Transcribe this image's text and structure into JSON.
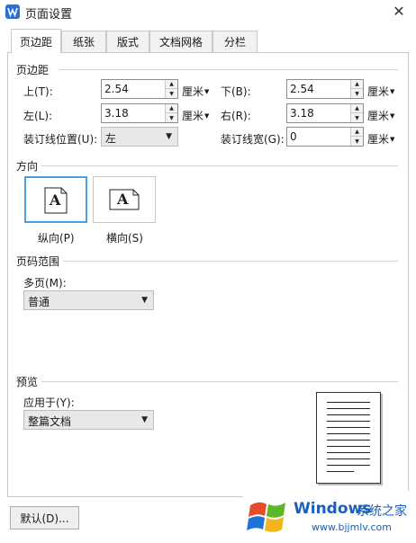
{
  "window": {
    "title": "页面设置",
    "close_glyph": "✕"
  },
  "tabs": [
    {
      "label": "页边距",
      "active": true
    },
    {
      "label": "纸张"
    },
    {
      "label": "版式"
    },
    {
      "label": "文档网格"
    },
    {
      "label": "分栏"
    }
  ],
  "margins": {
    "section_title": "页边距",
    "top": {
      "label": "上(T):",
      "value": "2.54",
      "unit": "厘米"
    },
    "bottom": {
      "label": "下(B):",
      "value": "2.54",
      "unit": "厘米"
    },
    "left": {
      "label": "左(L):",
      "value": "3.18",
      "unit": "厘米"
    },
    "right": {
      "label": "右(R):",
      "value": "3.18",
      "unit": "厘米"
    },
    "gutter_position": {
      "label": "装订线位置(U):",
      "value": "左"
    },
    "gutter_width": {
      "label": "装订线宽(G):",
      "value": "0",
      "unit": "厘米"
    }
  },
  "orientation": {
    "section_title": "方向",
    "portrait": {
      "label": "纵向(P)",
      "glyph": "A",
      "selected": true
    },
    "landscape": {
      "label": "横向(S)",
      "glyph": "A"
    }
  },
  "page_range": {
    "section_title": "页码范围",
    "multiple_pages": {
      "label": "多页(M):",
      "value": "普通"
    }
  },
  "preview": {
    "section_title": "预览",
    "apply_to": {
      "label": "应用于(Y):",
      "value": "整篇文档"
    }
  },
  "footer": {
    "default_button": "默认(D)..."
  },
  "watermark": {
    "brand": "Windows",
    "brand_cn": "系统之家",
    "url": "www.bjjmlv.com"
  },
  "colors": {
    "selection_border": "#4d9fe0",
    "app_icon": "#2a6fd6",
    "watermark_text": "#1a5fb4"
  }
}
